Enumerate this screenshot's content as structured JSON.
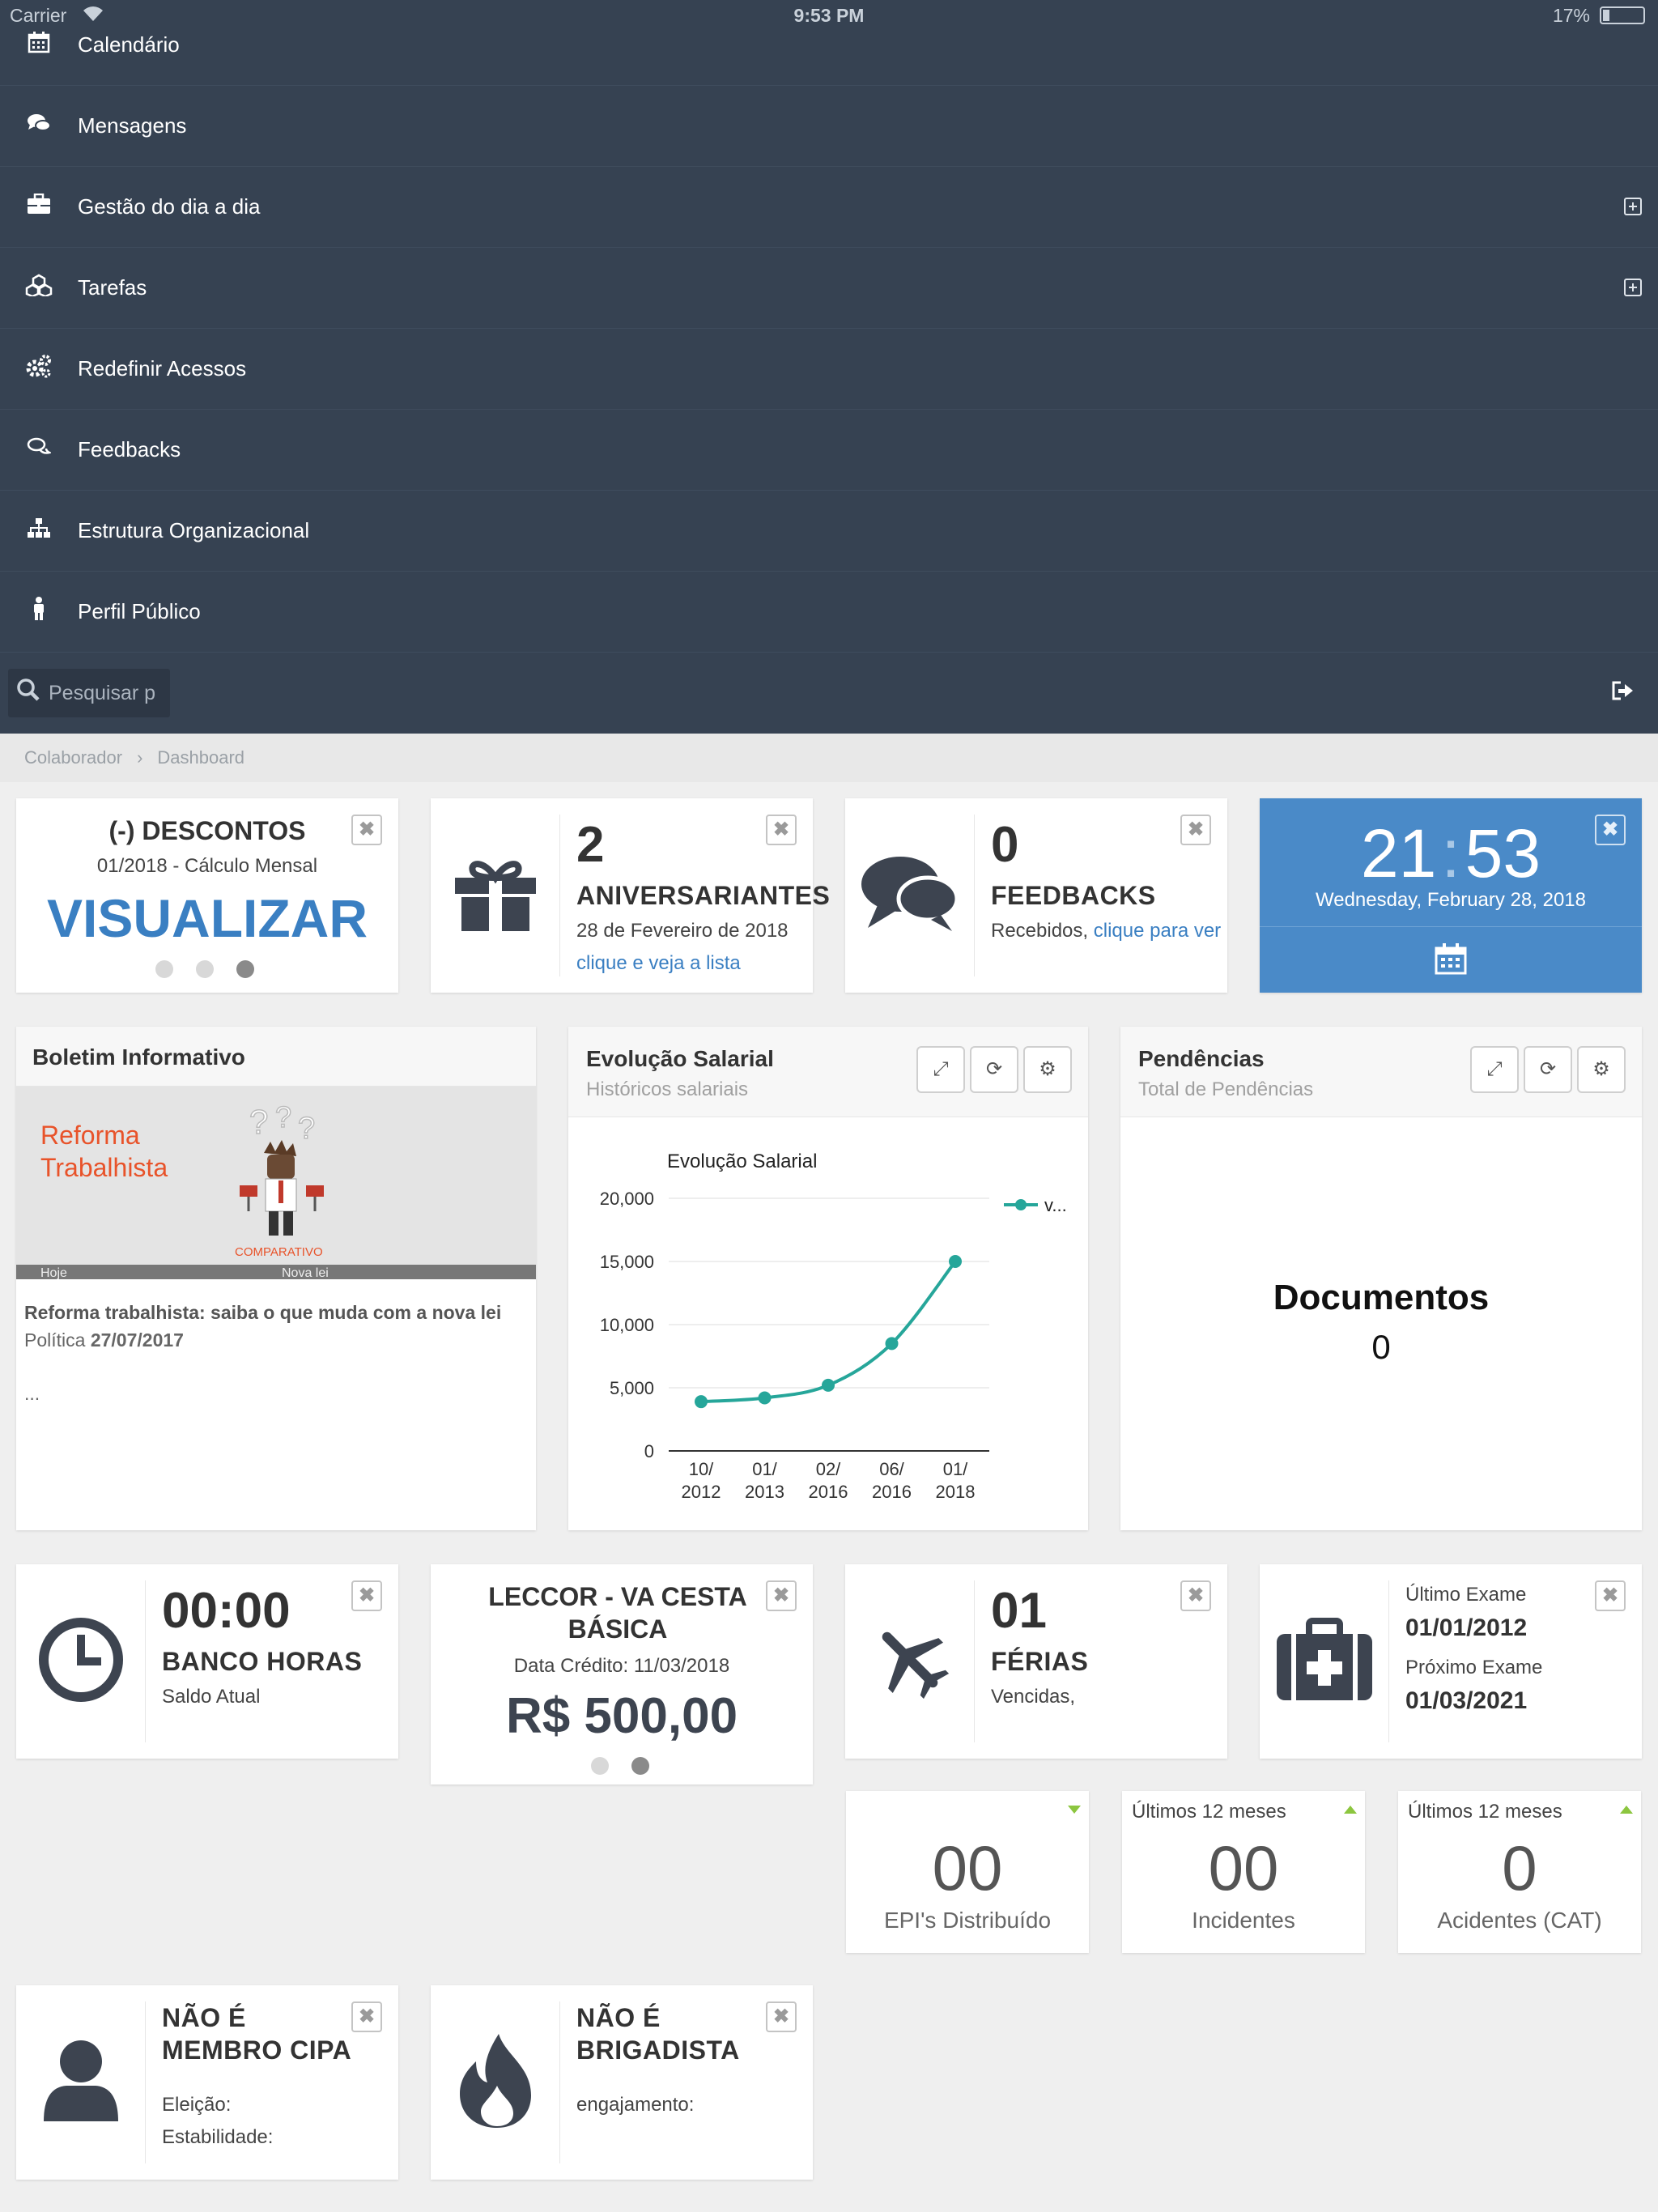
{
  "status_bar": {
    "carrier": "Carrier",
    "time": "9:53 PM",
    "battery": "17%"
  },
  "menu": [
    {
      "label": "Calendário",
      "icon": "calendar-icon",
      "expandable": false
    },
    {
      "label": "Mensagens",
      "icon": "comments-icon",
      "expandable": false
    },
    {
      "label": "Gestão do dia a dia",
      "icon": "briefcase-icon",
      "expandable": true
    },
    {
      "label": "Tarefas",
      "icon": "cubes-icon",
      "expandable": true
    },
    {
      "label": "Redefinir Acessos",
      "icon": "gears-icon",
      "expandable": false
    },
    {
      "label": "Feedbacks",
      "icon": "chat-bubbles-icon",
      "expandable": false
    },
    {
      "label": "Estrutura Organizacional",
      "icon": "sitemap-icon",
      "expandable": false
    },
    {
      "label": "Perfil Público",
      "icon": "person-icon",
      "expandable": false
    }
  ],
  "search": {
    "placeholder": "Pesquisar p"
  },
  "breadcrumb": {
    "items": [
      "Colaborador",
      "Dashboard"
    ]
  },
  "descontos": {
    "title": "(-) DESCONTOS",
    "subtitle": "01/2018 - Cálculo Mensal",
    "action": "VISUALIZAR"
  },
  "aniversariantes": {
    "count": "2",
    "title": "ANIVERSARIANTES",
    "date": "28 de Fevereiro de 2018",
    "link": "clique e veja a lista"
  },
  "feedbacks": {
    "count": "0",
    "title": "FEEDBACKS",
    "received": "Recebidos,",
    "link": "clique para ver"
  },
  "clock": {
    "hours": "21",
    "minutes": "53",
    "date": "Wednesday, February 28, 2018",
    "color": "#4a8ac8"
  },
  "boletim": {
    "title": "Boletim Informativo",
    "banner_title": "Reforma Trabalhista",
    "banner_caption": "COMPARATIVO",
    "banner_left": "Hoje",
    "banner_right": "Nova lei",
    "headline": "Reforma trabalhista: saiba o que muda com a nova lei",
    "category": "Política",
    "date": "27/07/2017",
    "more": "..."
  },
  "evolucao": {
    "title": "Evolução Salarial",
    "subtitle": "Históricos salariais"
  },
  "chart_data": {
    "type": "line",
    "title": "Evolução Salarial",
    "categories": [
      "10/\n2012",
      "01/\n2013",
      "02/\n2016",
      "06/\n2016",
      "01/\n2018"
    ],
    "series": [
      {
        "name": "v...",
        "values": [
          3900,
          4200,
          5200,
          8500,
          15000
        ]
      }
    ],
    "ylim": [
      0,
      20000
    ],
    "yticks": [
      "0",
      "5,000",
      "10,000",
      "15,000",
      "20,000"
    ],
    "color": "#26a69a",
    "legend": "top-right"
  },
  "pendencias": {
    "title": "Pendências",
    "subtitle": "Total de Pendências",
    "label": "Documentos",
    "value": "0"
  },
  "banco_horas": {
    "value": "00:00",
    "title": "BANCO HORAS",
    "sub": "Saldo Atual"
  },
  "leccor": {
    "title": "LECCOR - VA CESTA BÁSICA",
    "sub": "Data Crédito: 11/03/2018",
    "value": "R$ 500,00"
  },
  "ferias": {
    "value": "01",
    "title": "FÉRIAS",
    "sub": "Vencidas,"
  },
  "exame": {
    "last_label": "Último Exame",
    "last_date": "01/01/2012",
    "next_label": "Próximo Exame",
    "next_date": "01/03/2021"
  },
  "stats": [
    {
      "top": "",
      "value": "00",
      "label": "EPI's Distribuído",
      "trend": "down"
    },
    {
      "top": "Últimos 12 meses",
      "value": "00",
      "label": "Incidentes",
      "trend": "up"
    },
    {
      "top": "Últimos 12 meses",
      "value": "0",
      "label": "Acidentes (CAT)",
      "trend": "up"
    }
  ],
  "cipa": {
    "title": "NÃO É MEMBRO CIPA",
    "line1": "Eleição:",
    "line2": "Estabilidade:"
  },
  "brigadista": {
    "title": "NÃO É BRIGADISTA",
    "line1": "engajamento:"
  }
}
